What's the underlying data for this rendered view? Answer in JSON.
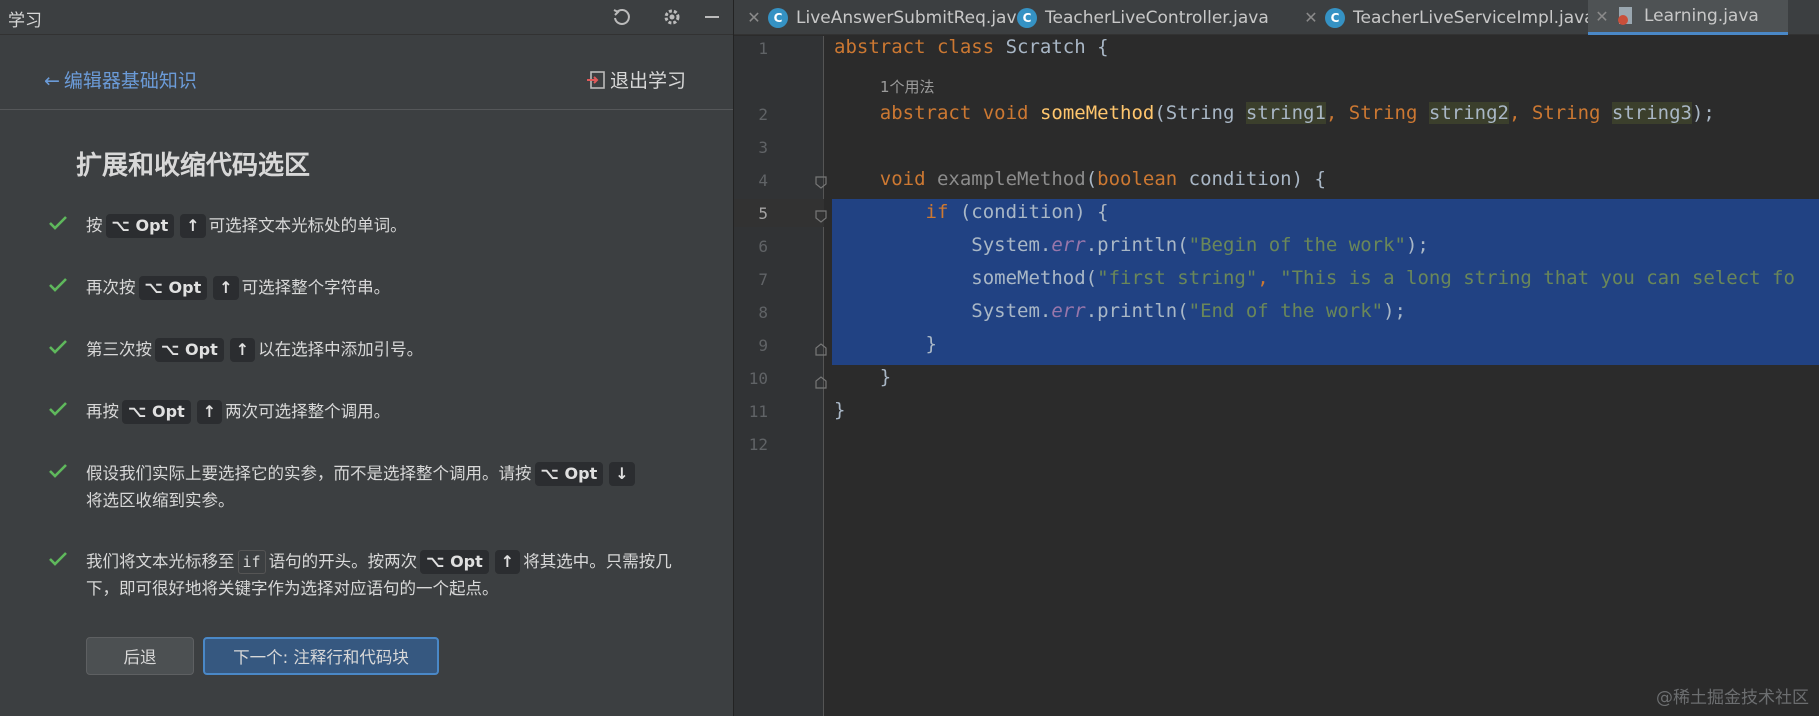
{
  "panel": {
    "title": "学习",
    "back_label": "编辑器基础知识",
    "exit_label": "退出学习",
    "lesson_title": "扩展和收缩代码选区",
    "key_opt": "⌥ Opt",
    "key_up": "↑",
    "key_down": "↓",
    "steps": [
      {
        "pre": "按",
        "post": "可选择文本光标处的单词。"
      },
      {
        "pre": "再次按",
        "post": "可选择整个字符串。"
      },
      {
        "pre": "第三次按",
        "post": "以在选择中添加引号。"
      },
      {
        "pre": "再按",
        "post": "两次可选择整个调用。"
      },
      {
        "pre": "假设我们实际上要选择它的实参，而不是选择整个调用。请按",
        "post": "将选区收缩到实参。"
      },
      {
        "pre": "我们将文本光标移至",
        "code": "if",
        "mid": "语句的开头。按两次",
        "post": "将其选中。只需按几下，即可很好地将关键字作为选择对应语句的一个起点。"
      }
    ],
    "btn_back": "后退",
    "btn_next": "下一个: 注释行和代码块"
  },
  "tabs": [
    {
      "label": "LiveAnswerSubmitReq.java"
    },
    {
      "label": "TeacherLiveController.java"
    },
    {
      "label": "TeacherLiveServiceImpl.java"
    },
    {
      "label": "Learning.java"
    }
  ],
  "editor": {
    "line_numbers": [
      "1",
      "2",
      "3",
      "4",
      "5",
      "6",
      "7",
      "8",
      "9",
      "10",
      "11",
      "12"
    ],
    "usage_hint": "1个用法",
    "lines": {
      "l1_kw": "abstract class",
      "l1_rest": " Scratch {",
      "l2_kw": "abstract void",
      "l2_fn": "someMethod",
      "l2_a": "(String ",
      "l2_p1": "string1",
      "l2_b": ", String ",
      "l2_p2": "string2",
      "l2_c": ", String ",
      "l2_p3": "string3",
      "l2_d": ");",
      "l4_kw": "void",
      "l4_fn": " exampleMethod",
      "l4_a": "(",
      "l4_kw2": "boolean",
      "l4_b": " condition) {",
      "l5_kw": "if",
      "l5_rest": " (condition) {",
      "l6_a": "System.",
      "l6_fld": "err",
      "l6_b": ".println(",
      "l6_str": "\"Begin of the work\"",
      "l6_c": ");",
      "l7_a": "someMethod(",
      "l7_s1": "\"first string\"",
      "l7_b": ", ",
      "l7_s2": "\"This is a long string that you can select fo",
      "l8_a": "System.",
      "l8_fld": "err",
      "l8_b": ".println(",
      "l8_str": "\"End of the work\"",
      "l8_c": ");",
      "l9": "}",
      "l10": "}",
      "l11": "}"
    }
  },
  "watermark": "@稀土掘金技术社区"
}
